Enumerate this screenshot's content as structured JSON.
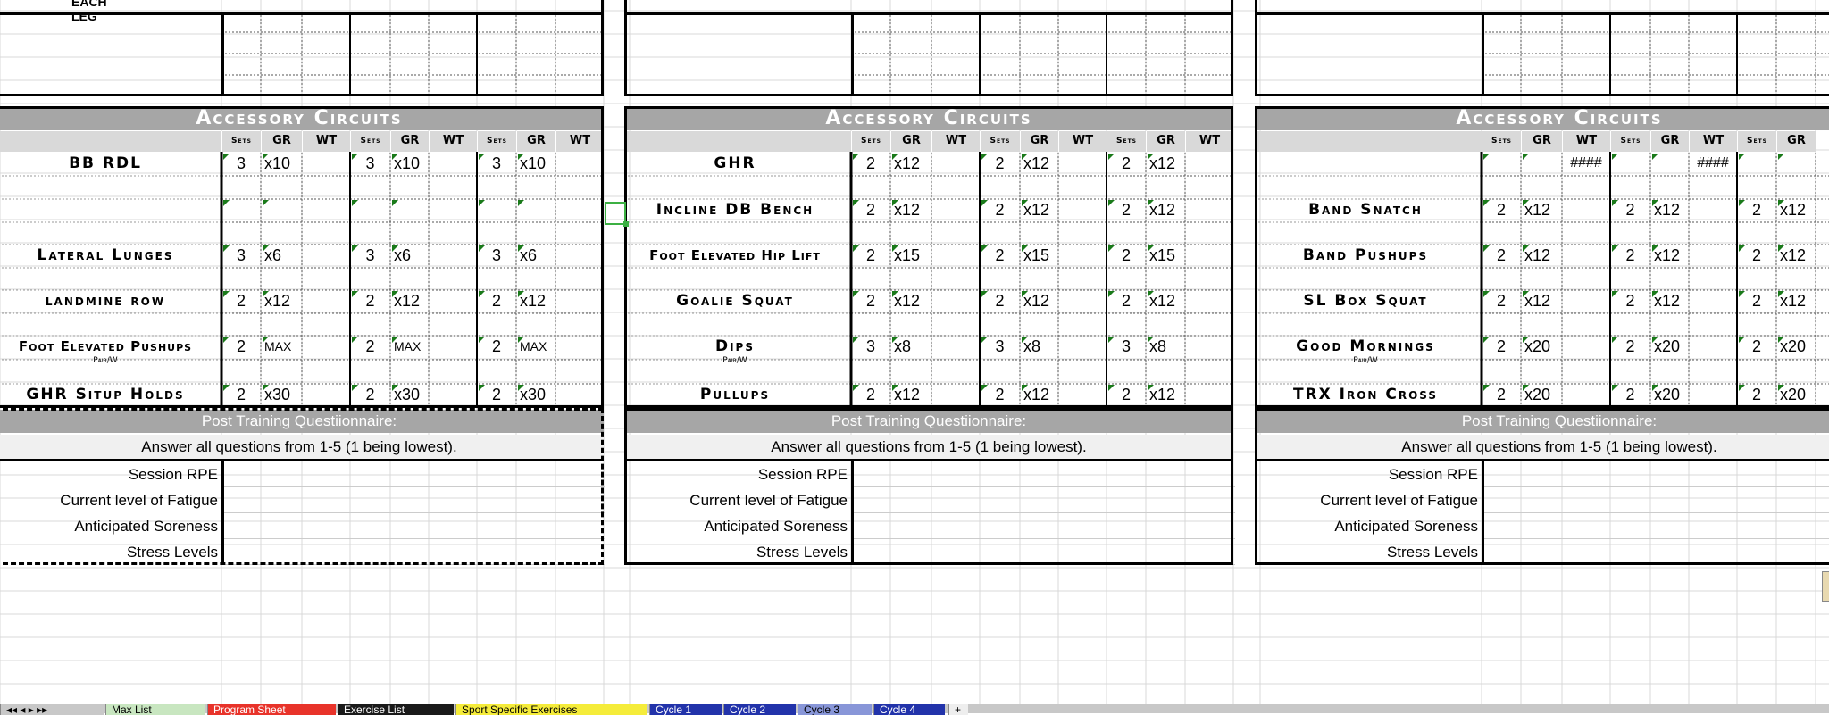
{
  "blocks": [
    {
      "top_label": "EACH LEG",
      "header": "Accessory Circuits",
      "subheads": [
        "Sets",
        "GR",
        "WT",
        "Sets",
        "GR",
        "WT",
        "Sets",
        "GR",
        "WT"
      ],
      "exercises": [
        {
          "name": "BB RDL",
          "sets": "3",
          "gr": "x10"
        },
        {
          "name": "",
          "sets": "",
          "gr": ""
        },
        {
          "name": "Lateral Lunges",
          "sets": "3",
          "gr": "x6"
        },
        {
          "name": "landmine row",
          "sets": "2",
          "gr": "x12"
        },
        {
          "name": "Foot Elevated Pushups",
          "sets": "2",
          "gr": "MAX",
          "pair": "Pair/W"
        },
        {
          "name": "GHR Situp Holds",
          "sets": "2",
          "gr": "x30"
        }
      ],
      "wt_values": [
        "",
        "",
        ""
      ],
      "questionnaire": {
        "title": "Post Training Questiionnaire:",
        "instructions": "Answer all questions from 1-5 (1 being lowest).",
        "items": [
          "Session RPE",
          "Current level of Fatigue",
          "Anticipated Soreness",
          "Stress Levels"
        ]
      }
    },
    {
      "top_label": "",
      "header": "Accessory Circuits",
      "subheads": [
        "Sets",
        "GR",
        "WT",
        "Sets",
        "GR",
        "WT",
        "Sets",
        "GR",
        "WT"
      ],
      "exercises": [
        {
          "name": "GHR",
          "sets": "2",
          "gr": "x12"
        },
        {
          "name": "Incline DB Bench",
          "sets": "2",
          "gr": "x12"
        },
        {
          "name": "Foot Elevated Hip Lift",
          "sets": "2",
          "gr": "x15"
        },
        {
          "name": "Goalie Squat",
          "sets": "2",
          "gr": "x12"
        },
        {
          "name": "Dips",
          "sets": "3",
          "gr": "x8",
          "pair": "Pair/W"
        },
        {
          "name": "Pullups",
          "sets": "2",
          "gr": "x12"
        }
      ],
      "wt_values": [
        "",
        "",
        ""
      ],
      "questionnaire": {
        "title": "Post Training Questiionnaire:",
        "instructions": "Answer all questions from 1-5 (1 being lowest).",
        "items": [
          "Session RPE",
          "Current level of Fatigue",
          "Anticipated Soreness",
          "Stress Levels"
        ]
      }
    },
    {
      "top_label": "",
      "header": "Accessory Circuits",
      "subheads": [
        "Sets",
        "GR",
        "WT",
        "Sets",
        "GR",
        "WT",
        "Sets",
        "GR"
      ],
      "exercises": [
        {
          "name": "",
          "sets": "",
          "gr": ""
        },
        {
          "name": "Band Snatch",
          "sets": "2",
          "gr": "x12"
        },
        {
          "name": "Band Pushups",
          "sets": "2",
          "gr": "x12"
        },
        {
          "name": "SL Box Squat",
          "sets": "2",
          "gr": "x12"
        },
        {
          "name": "Good Mornings",
          "sets": "2",
          "gr": "x20",
          "pair": "Pair/W"
        },
        {
          "name": "TRX Iron Cross",
          "sets": "2",
          "gr": "x20"
        }
      ],
      "wt_values": [
        "####",
        "####",
        "#"
      ],
      "questionnaire": {
        "title": "Post Training Questiionnaire:",
        "instructions": "Answer all questions from 1-5 (1 being lowest).",
        "items": [
          "Session RPE",
          "Current level of Fatigue",
          "Anticipated Soreness",
          "Stress Levels"
        ]
      }
    }
  ],
  "sheet_tabs": [
    {
      "label": "Max List",
      "color": "#c8e6c0"
    },
    {
      "label": "Program Sheet",
      "color": "#e8332a"
    },
    {
      "label": "Exercise List",
      "color": "#1a1a1a"
    },
    {
      "label": "Sport Specific Exercises",
      "color": "#f5ec3a"
    },
    {
      "label": "Cycle 1",
      "color": "#2233aa"
    },
    {
      "label": "Cycle 2",
      "color": "#2233aa"
    },
    {
      "label": "Cycle 3",
      "color": "#8896d8"
    },
    {
      "label": "Cycle 4",
      "color": "#2233aa"
    }
  ],
  "add_sheet_label": "+"
}
